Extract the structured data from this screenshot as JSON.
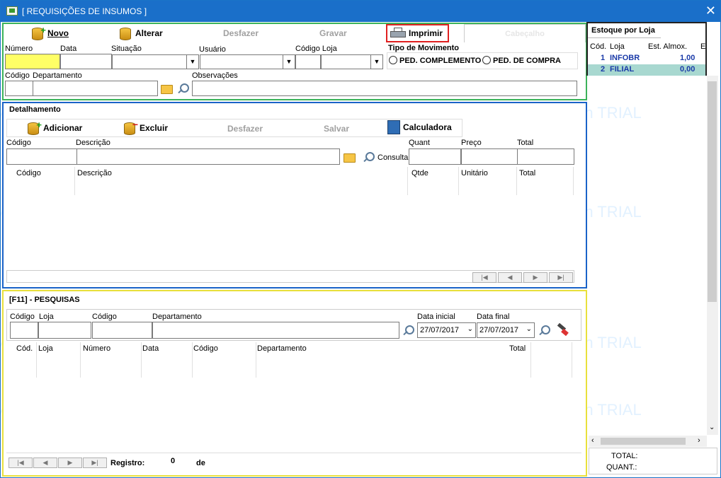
{
  "window": {
    "title": "[ REQUISIÇÕES DE INSUMOS ]",
    "close": "✕"
  },
  "toolbar": {
    "novo": "Novo",
    "alterar": "Alterar",
    "desfazer": "Desfazer",
    "gravar": "Gravar",
    "imprimir": "Imprimir",
    "cabecalho": "Cabeçalho"
  },
  "header_fields": {
    "numero": "Número",
    "data": "Data",
    "situacao": "Situação",
    "usuario": "Usuário",
    "codigo_loja": "Código Loja",
    "tipo_movimento": "Tipo de Movimento",
    "ped_complemento": "PED. COMPLEMENTO",
    "ped_compra": "PED. DE COMPRA",
    "codigo": "Código",
    "departamento": "Departamento",
    "observacoes": "Observações"
  },
  "detalhamento": {
    "title": "Detalhamento",
    "adicionar": "Adicionar",
    "excluir": "Excluir",
    "desfazer": "Desfazer",
    "salvar": "Salvar",
    "calculadora": "Calculadora",
    "codigo": "Código",
    "descricao": "Descrição",
    "quant": "Quant",
    "preco": "Preço",
    "total": "Total",
    "consulta": "Consulta",
    "grid": {
      "codigo": "Código",
      "descricao": "Descrição",
      "qtde": "Qtde",
      "unitario": "Unitário",
      "total": "Total"
    }
  },
  "pesquisas": {
    "title": "[F11] - PESQUISAS",
    "codigo": "Código",
    "loja": "Loja",
    "codigo2": "Código",
    "departamento": "Departamento",
    "data_inicial": "Data inicial",
    "data_final": "Data final",
    "data_inicial_val": "27/07/2017",
    "data_final_val": "27/07/2017",
    "grid": {
      "cod": "Cód.",
      "loja": "Loja",
      "numero": "Número",
      "data": "Data",
      "codigo": "Código",
      "departamento": "Departamento",
      "total": "Total"
    },
    "registro": "Registro:",
    "registro_val": "0",
    "de": "de"
  },
  "estoque": {
    "title": "Estoque por Loja",
    "headers": {
      "cod": "Cód.",
      "loja": "Loja",
      "est": "Est. Almox.",
      "e": "E"
    },
    "rows": [
      {
        "cod": "1",
        "loja": "INFOBR",
        "est": "1,00"
      },
      {
        "cod": "2",
        "loja": "FILIAL",
        "est": "0,00"
      }
    ],
    "total": "TOTAL:",
    "quant": "QUANT.:"
  },
  "watermark": "Made with Dr.Explain TRIAL",
  "colors": {
    "titlebar": "#1a6fc9",
    "green_border": "#3cb35a",
    "blue_border": "#1a63c8",
    "yellow_border": "#e8e03c",
    "highlight": "#ffff66",
    "selected_row": "#a8d8d0"
  }
}
